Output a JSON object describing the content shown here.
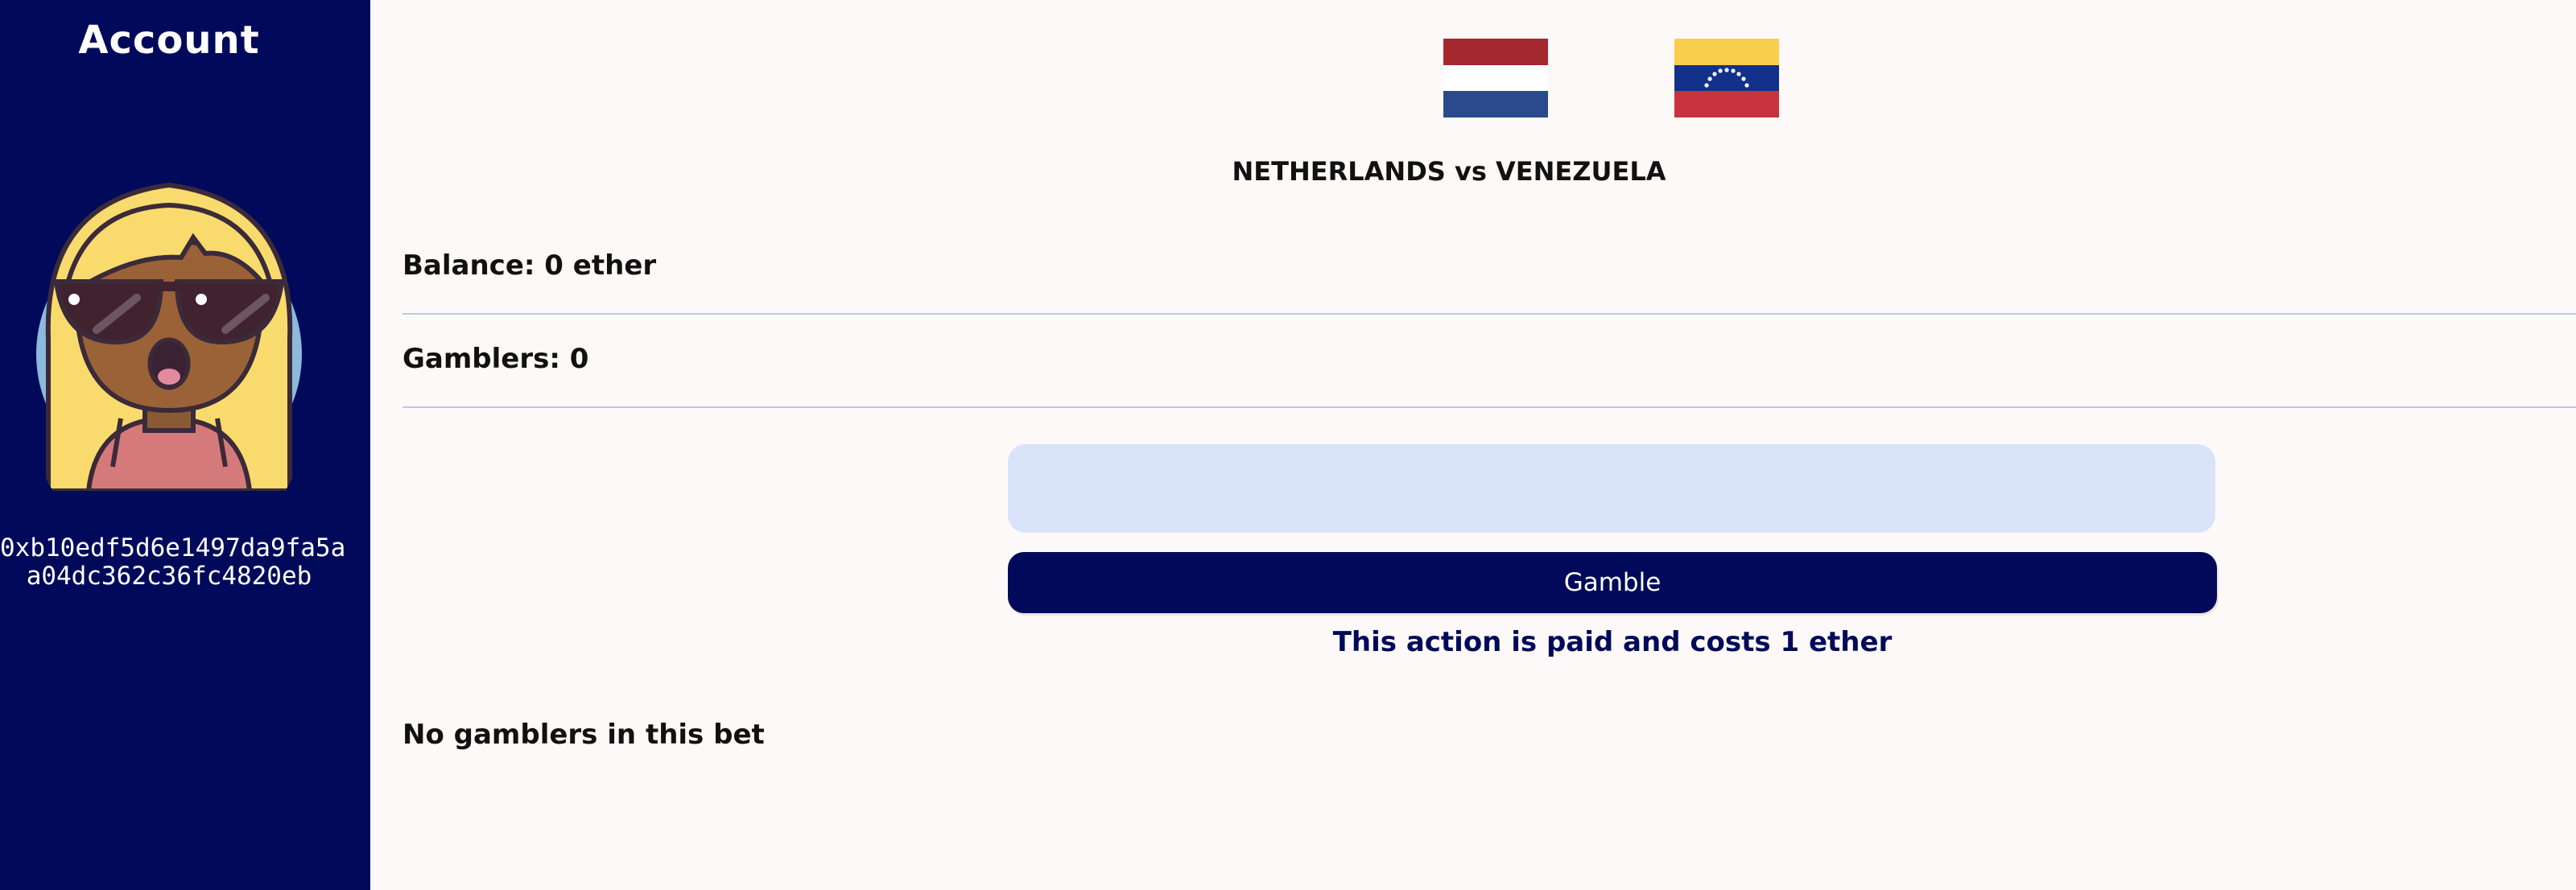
{
  "sidebar": {
    "title": "Account",
    "avatar_icon": "avatar-woman-sunglasses-icon",
    "address": "0xb10edf5d6e1497da9fa5a\na04dc362c36fc4820eb"
  },
  "match": {
    "home_flag_icon": "netherlands-flag-icon",
    "away_flag_icon": "venezuela-flag-icon",
    "title": "NETHERLANDS vs VENEZUELA"
  },
  "stats": {
    "balance": "Balance: 0 ether",
    "gamblers": "Gamblers: 0"
  },
  "bet_form": {
    "input_value": "",
    "button_label": "Gamble",
    "cost_note": "This action is paid and costs 1 ether"
  },
  "gamblers_list": {
    "empty_message": "No gamblers in this bet"
  },
  "colors": {
    "sidebar_bg": "#010a5a",
    "page_bg": "#fdf9f8",
    "input_bg": "#d9e3f9",
    "button_bg": "#010a5a"
  }
}
